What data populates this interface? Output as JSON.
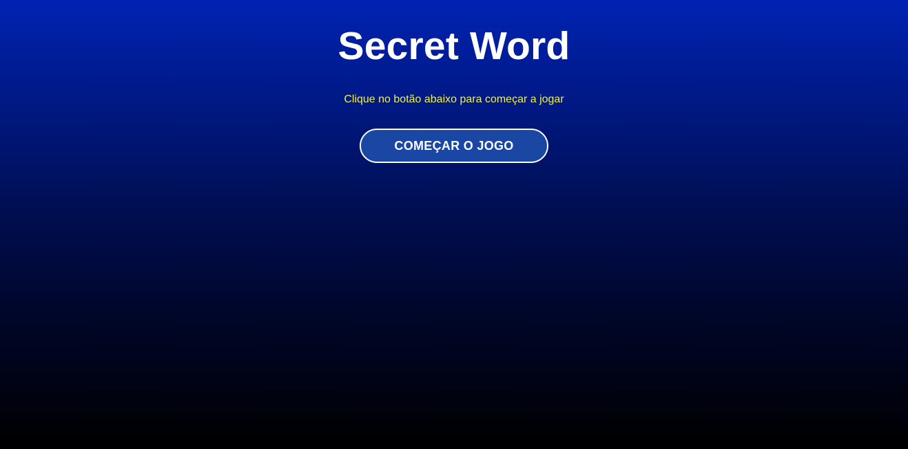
{
  "start_screen": {
    "title": "Secret Word",
    "subtitle": "Clique no botão abaixo para começar a jogar",
    "start_button_label": "COMEÇAR O JOGO"
  },
  "colors": {
    "background_top": "#0023b3",
    "background_bottom": "#000000",
    "title_text": "#ffffff",
    "subtitle_text": "#f2f23a",
    "button_fill": "#1a47a3",
    "button_border": "#ffffff"
  }
}
